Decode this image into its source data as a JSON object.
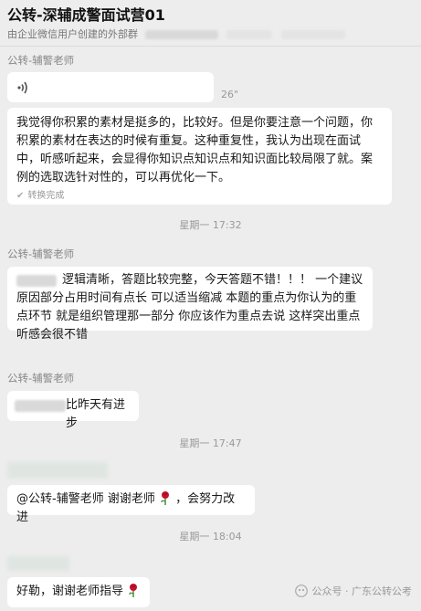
{
  "header": {
    "title": "公转-深辅成警面试营01",
    "subtitle": "由企业微信用户创建的外部群"
  },
  "messages": [
    {
      "sender": "公转-辅警老师",
      "type": "voice",
      "duration": "26\"",
      "transcription": "我觉得你积累的素材是挺多的，比较好。但是你要注意一个问题，你积累的素材在表达的时候有重复。这种重复性，我认为出现在面试中，听感听起来，会显得你知识点知识点和知识面比较局限了就。案例的选取选针对性的，可以再优化一下。",
      "transcribed_label": "转换完成"
    },
    {
      "time": "星期一 17:32"
    },
    {
      "sender": "公转-辅警老师",
      "type": "text",
      "text": "逻辑清晰，答题比较完整，今天答题不错！！！  一个建议 原因部分占用时间有点长 可以适当缩减 本题的重点为你认为的重点环节 就是组织管理那一部分 你应该作为重点去说 这样突出重点听感会很不错"
    },
    {
      "sender": "公转-辅警老师",
      "type": "text",
      "text": "比昨天有进步"
    },
    {
      "time": "星期一 17:47"
    },
    {
      "type": "text",
      "text": "@公转-辅警老师 谢谢老师",
      "text_after": "，会努力改进"
    },
    {
      "time": "星期一 18:04"
    },
    {
      "type": "text",
      "text": "好勒，谢谢老师指导"
    }
  ],
  "watermark": {
    "text": "公众号 · 广东公转公考"
  },
  "colors": {
    "background": "#ededed",
    "bubble": "#ffffff",
    "meta": "#999999",
    "rose": "#c8102e"
  },
  "icons": [
    "voice-wave-icon",
    "check-icon",
    "rose-icon",
    "wechat-official-icon"
  ]
}
